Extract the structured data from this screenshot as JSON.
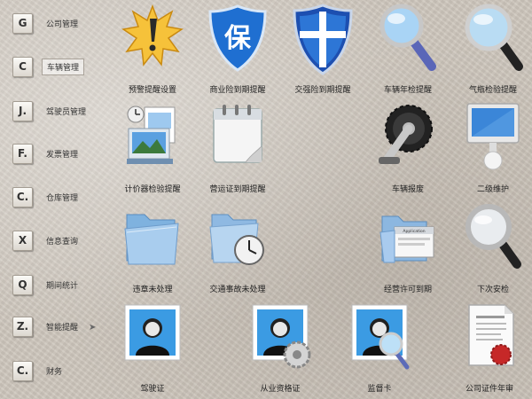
{
  "sidebar": {
    "items": [
      {
        "key": "G",
        "label": "公司管理"
      },
      {
        "key": "C",
        "label": "车辆管理"
      },
      {
        "key": "J.",
        "label": "驾驶员管理"
      },
      {
        "key": "F.",
        "label": "发票管理"
      },
      {
        "key": "C.",
        "label": "仓库管理"
      },
      {
        "key": "X",
        "label": "信息查询"
      },
      {
        "key": "Q",
        "label": "期间统计"
      },
      {
        "key": "Z.",
        "label": "智能提醒"
      },
      {
        "key": "C.",
        "label": "财务"
      }
    ]
  },
  "tiles": [
    {
      "label": "预警提醒设置",
      "icon": "alert-burst-icon"
    },
    {
      "label": "商业险到期提醒",
      "icon": "insurance-shield-icon",
      "glyph": "保"
    },
    {
      "label": "交强险到期提醒",
      "icon": "cross-shield-icon"
    },
    {
      "label": "车辆年检提醒",
      "icon": "magnifier-icon"
    },
    {
      "label": "气瓶检验提醒",
      "icon": "magnifier-large-icon"
    },
    {
      "label": "计价器检验提醒",
      "icon": "photo-stack-icon"
    },
    {
      "label": "营运证到期提醒",
      "icon": "calendar-icon"
    },
    {
      "label": "车辆报废",
      "icon": "crankset-icon"
    },
    {
      "label": "二级维护",
      "icon": "imac-icon"
    },
    {
      "label": "违章未处理",
      "icon": "folder-icon"
    },
    {
      "label": "交通事故未处理",
      "icon": "folder-clock-icon"
    },
    {
      "label": "经营许可到期",
      "icon": "application-folder-icon",
      "glyph": "Application"
    },
    {
      "label": "下次安检",
      "icon": "magnifier-silver-icon"
    },
    {
      "label": "驾驶证",
      "icon": "user-card-icon"
    },
    {
      "label": "从业资格证",
      "icon": "user-card-gear-icon"
    },
    {
      "label": "监督卡",
      "icon": "user-card-magnifier-icon"
    },
    {
      "label": "公司证件年审",
      "icon": "certificate-icon"
    }
  ]
}
